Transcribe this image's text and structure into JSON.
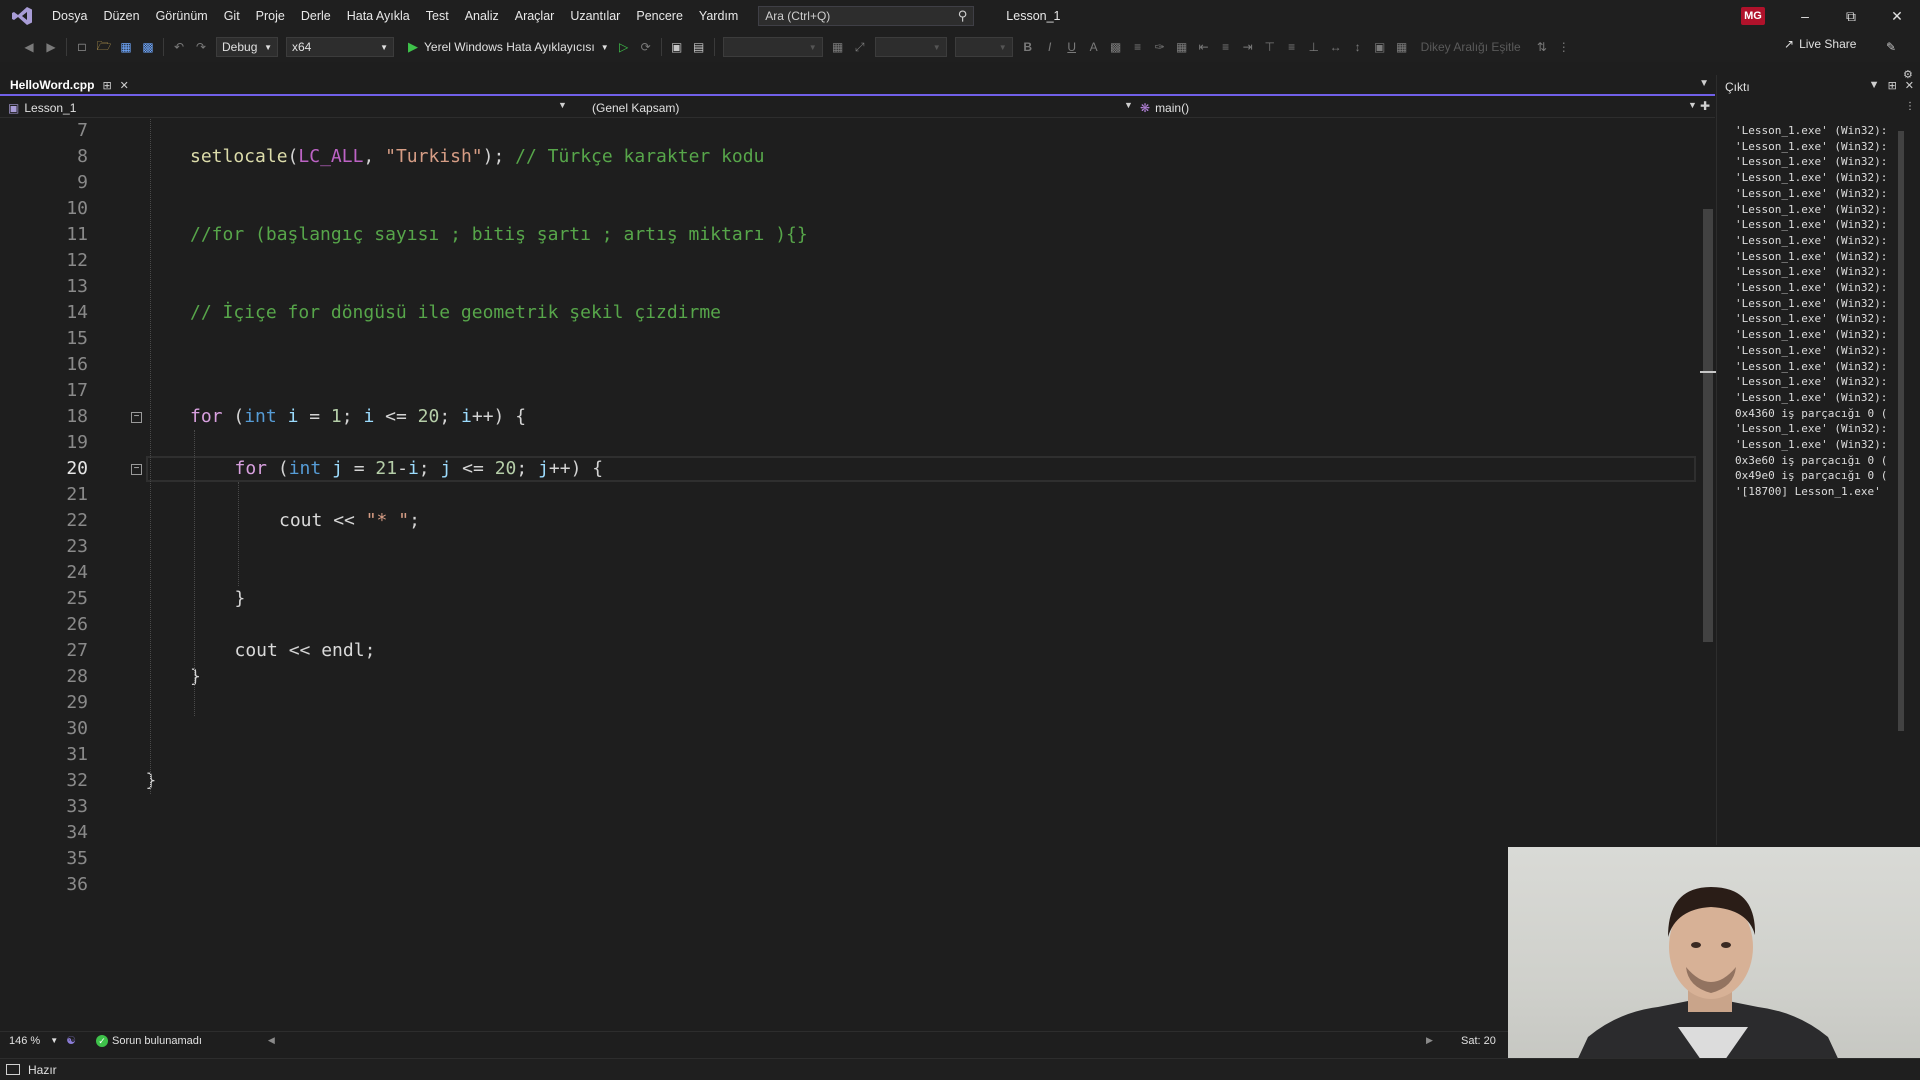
{
  "menu": [
    "Dosya",
    "Düzen",
    "Görünüm",
    "Git",
    "Proje",
    "Derle",
    "Hata Ayıkla",
    "Test",
    "Analiz",
    "Araçlar",
    "Uzantılar",
    "Pencere",
    "Yardım"
  ],
  "search": {
    "placeholder": "Ara (Ctrl+Q)"
  },
  "solution_name": "Lesson_1",
  "user_initials": "MG",
  "toolbar": {
    "configuration": "Debug",
    "platform": "x64",
    "run_label": "Yerel Windows Hata Ayıklayıcısı",
    "align_label": "Dikey Aralığı Eşitle",
    "live_share": "Live Share"
  },
  "document_tab": {
    "title": "HelloWord.cpp"
  },
  "navbar": {
    "project": "Lesson_1",
    "scope": "(Genel Kapsam)",
    "member": "main()"
  },
  "editor": {
    "current_line": 20,
    "lines": [
      {
        "n": "7",
        "text": ""
      },
      {
        "n": "8",
        "text": "setlocale(LC_ALL, \"Turkish\"); // Türkçe karakter kodu"
      },
      {
        "n": "9",
        "text": ""
      },
      {
        "n": "10",
        "text": ""
      },
      {
        "n": "11",
        "text": "//for (başlangıç sayısı ; bitiş şartı ; artış miktarı ){}"
      },
      {
        "n": "12",
        "text": ""
      },
      {
        "n": "13",
        "text": ""
      },
      {
        "n": "14",
        "text": "// İçiçe for döngüsü ile geometrik şekil çizdirme"
      },
      {
        "n": "15",
        "text": ""
      },
      {
        "n": "16",
        "text": ""
      },
      {
        "n": "17",
        "text": ""
      },
      {
        "n": "18",
        "text": "for (int i = 1; i <= 20; i++) {"
      },
      {
        "n": "19",
        "text": ""
      },
      {
        "n": "20",
        "text": "for (int j = 21-i; j <= 20; j++) {"
      },
      {
        "n": "21",
        "text": ""
      },
      {
        "n": "22",
        "text": "cout << \"* \";"
      },
      {
        "n": "23",
        "text": ""
      },
      {
        "n": "24",
        "text": ""
      },
      {
        "n": "25",
        "text": "}"
      },
      {
        "n": "26",
        "text": ""
      },
      {
        "n": "27",
        "text": "cout << endl;"
      },
      {
        "n": "28",
        "text": "}"
      },
      {
        "n": "29",
        "text": ""
      },
      {
        "n": "30",
        "text": ""
      },
      {
        "n": "31",
        "text": ""
      },
      {
        "n": "32",
        "text": "}"
      },
      {
        "n": "33",
        "text": ""
      },
      {
        "n": "34",
        "text": ""
      },
      {
        "n": "35",
        "text": ""
      },
      {
        "n": "36",
        "text": ""
      }
    ]
  },
  "status": {
    "zoom": "146 %",
    "issues": "Sorun bulunamadı",
    "line": "Sat: 20",
    "ready": "Hazır"
  },
  "output": {
    "title": "Çıktı",
    "lines": [
      "'Lesson_1.exe' (Win32):",
      "'Lesson_1.exe' (Win32):",
      "'Lesson_1.exe' (Win32):",
      "'Lesson_1.exe' (Win32):",
      "'Lesson_1.exe' (Win32):",
      "'Lesson_1.exe' (Win32):",
      "'Lesson_1.exe' (Win32):",
      "'Lesson_1.exe' (Win32):",
      "'Lesson_1.exe' (Win32):",
      "'Lesson_1.exe' (Win32):",
      "'Lesson_1.exe' (Win32):",
      "'Lesson_1.exe' (Win32):",
      "'Lesson_1.exe' (Win32):",
      "'Lesson_1.exe' (Win32):",
      "'Lesson_1.exe' (Win32):",
      "'Lesson_1.exe' (Win32):",
      "'Lesson_1.exe' (Win32):",
      "'Lesson_1.exe' (Win32):",
      "0x4360 iş parçacığı 0 (",
      "'Lesson_1.exe' (Win32):",
      "'Lesson_1.exe' (Win32):",
      "0x3e60 iş parçacığı 0 (",
      "0x49e0 iş parçacığı 0 (",
      "'[18700] Lesson_1.exe'"
    ]
  },
  "colors": {
    "accent": "#7160e8",
    "keyword": "#569cd6",
    "comment": "#57a64a",
    "string": "#d69d85",
    "avatar": "#b0122b",
    "run": "#3ec24a"
  }
}
